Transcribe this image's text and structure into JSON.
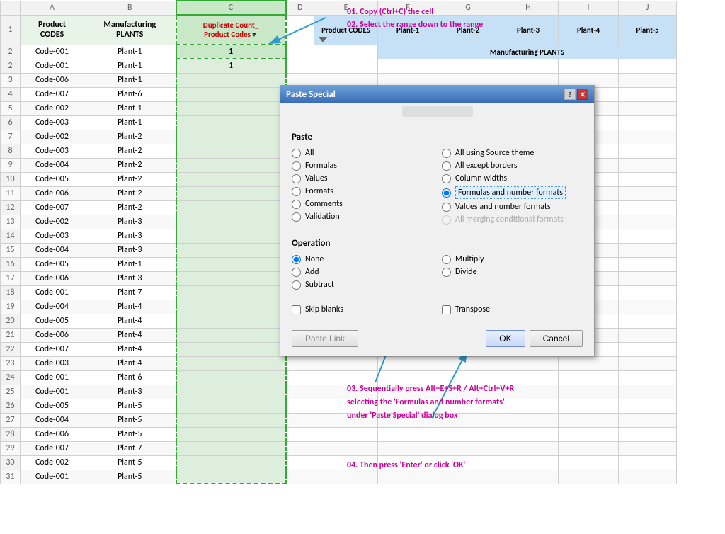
{
  "spreadsheet": {
    "col_headers": [
      "",
      "A",
      "B",
      "C",
      "D",
      "E",
      "F",
      "G",
      "H",
      "I",
      "J"
    ],
    "header_row": {
      "col_a": "Product CODES",
      "col_b": "Manufacturing PLANTS",
      "col_c": "Duplicate Count_ Product Codes",
      "col_d": "",
      "col_e": "Product CODES",
      "col_f": "Plant-1",
      "col_g": "Plant-2",
      "col_h": "Plant-3",
      "col_i": "Plant-4",
      "col_j": "Plant-5"
    },
    "header_row2": {
      "col_f": "Manufacturing PLANTS"
    },
    "data": [
      {
        "row": 2,
        "a": "Code-001",
        "b": "Plant-1",
        "c": "1"
      },
      {
        "row": 3,
        "a": "Code-006",
        "b": "Plant-1",
        "c": ""
      },
      {
        "row": 4,
        "a": "Code-007",
        "b": "Plant-6",
        "c": ""
      },
      {
        "row": 5,
        "a": "Code-002",
        "b": "Plant-1",
        "c": ""
      },
      {
        "row": 6,
        "a": "Code-003",
        "b": "Plant-1",
        "c": ""
      },
      {
        "row": 7,
        "a": "Code-002",
        "b": "Plant-2",
        "c": ""
      },
      {
        "row": 8,
        "a": "Code-003",
        "b": "Plant-2",
        "c": ""
      },
      {
        "row": 9,
        "a": "Code-004",
        "b": "Plant-2",
        "c": ""
      },
      {
        "row": 10,
        "a": "Code-005",
        "b": "Plant-2",
        "c": ""
      },
      {
        "row": 11,
        "a": "Code-006",
        "b": "Plant-2",
        "c": ""
      },
      {
        "row": 12,
        "a": "Code-007",
        "b": "Plant-2",
        "c": ""
      },
      {
        "row": 13,
        "a": "Code-002",
        "b": "Plant-3",
        "c": ""
      },
      {
        "row": 14,
        "a": "Code-003",
        "b": "Plant-3",
        "c": ""
      },
      {
        "row": 15,
        "a": "Code-004",
        "b": "Plant-3",
        "c": ""
      },
      {
        "row": 16,
        "a": "Code-005",
        "b": "Plant-1",
        "c": ""
      },
      {
        "row": 17,
        "a": "Code-006",
        "b": "Plant-3",
        "c": ""
      },
      {
        "row": 18,
        "a": "Code-001",
        "b": "Plant-7",
        "c": ""
      },
      {
        "row": 19,
        "a": "Code-004",
        "b": "Plant-4",
        "c": ""
      },
      {
        "row": 20,
        "a": "Code-005",
        "b": "Plant-4",
        "c": ""
      },
      {
        "row": 21,
        "a": "Code-006",
        "b": "Plant-4",
        "c": ""
      },
      {
        "row": 22,
        "a": "Code-007",
        "b": "Plant-4",
        "c": ""
      },
      {
        "row": 23,
        "a": "Code-003",
        "b": "Plant-4",
        "c": ""
      },
      {
        "row": 24,
        "a": "Code-001",
        "b": "Plant-6",
        "c": ""
      },
      {
        "row": 25,
        "a": "Code-001",
        "b": "Plant-3",
        "c": ""
      },
      {
        "row": 26,
        "a": "Code-005",
        "b": "Plant-5",
        "c": ""
      },
      {
        "row": 27,
        "a": "Code-004",
        "b": "Plant-5",
        "c": ""
      },
      {
        "row": 28,
        "a": "Code-006",
        "b": "Plant-5",
        "c": ""
      },
      {
        "row": 29,
        "a": "Code-007",
        "b": "Plant-7",
        "c": ""
      },
      {
        "row": 30,
        "a": "Code-002",
        "b": "Plant-5",
        "c": ""
      },
      {
        "row": 31,
        "a": "Code-001",
        "b": "Plant-5",
        "c": ""
      }
    ]
  },
  "dialog": {
    "title": "Paste Special",
    "subtitle": "Paste Special",
    "paste_label": "Paste",
    "paste_options": [
      {
        "id": "all",
        "label": "All",
        "checked": false
      },
      {
        "id": "formulas",
        "label": "Formulas",
        "checked": false
      },
      {
        "id": "values",
        "label": "Values",
        "checked": false
      },
      {
        "id": "formats",
        "label": "Formats",
        "checked": false
      },
      {
        "id": "comments",
        "label": "Comments",
        "checked": false
      },
      {
        "id": "validation",
        "label": "Validation",
        "checked": false
      }
    ],
    "paste_options_right": [
      {
        "id": "all_source",
        "label": "All using Source theme",
        "checked": false
      },
      {
        "id": "all_except",
        "label": "All except borders",
        "checked": false
      },
      {
        "id": "col_widths",
        "label": "Column widths",
        "checked": false
      },
      {
        "id": "formulas_num",
        "label": "Formulas and number formats",
        "checked": true
      },
      {
        "id": "values_num",
        "label": "Values and number formats",
        "checked": false
      },
      {
        "id": "merging",
        "label": "All merging conditional formats",
        "checked": false,
        "disabled": true
      }
    ],
    "operation_label": "Operation",
    "operation_options": [
      {
        "id": "none",
        "label": "None",
        "checked": true
      },
      {
        "id": "add",
        "label": "Add",
        "checked": false
      },
      {
        "id": "subtract",
        "label": "Subtract",
        "checked": false
      }
    ],
    "operation_options_right": [
      {
        "id": "multiply",
        "label": "Multiply",
        "checked": false
      },
      {
        "id": "divide",
        "label": "Divide",
        "checked": false
      }
    ],
    "skip_blanks_label": "Skip blanks",
    "transpose_label": "Transpose",
    "paste_link_label": "Paste Link",
    "ok_label": "OK",
    "cancel_label": "Cancel"
  },
  "annotations": {
    "step1": "01. Copy (Ctrl+C) the cell",
    "step2": "02. Select the range down to the range",
    "step3": "03. Sequentially press Alt+E+S+R / Alt+Ctrl+V+R",
    "step3b": "selecting the 'Formulas and number formats'",
    "step3c": "under 'Paste Special' dialog box",
    "step4": "04. Then press 'Enter' or click 'OK'"
  }
}
